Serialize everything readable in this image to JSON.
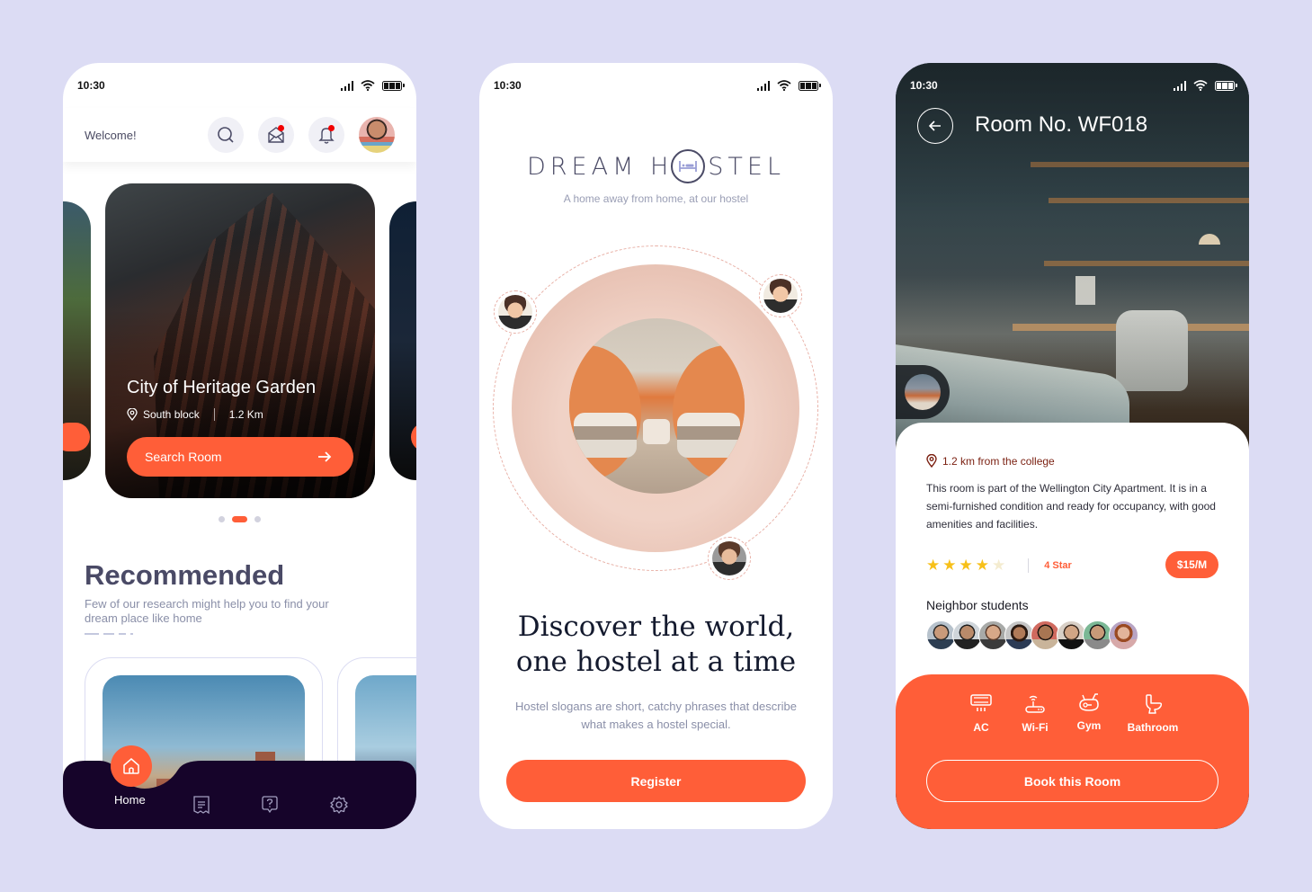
{
  "status_bar": {
    "time": "10:30"
  },
  "screen_home": {
    "header": {
      "welcome": "Welcome!",
      "icons": [
        "search-icon",
        "mail-icon",
        "bell-icon"
      ],
      "notification_dot_color": "#f20000"
    },
    "carousel": {
      "active_index": 1,
      "total": 3,
      "card": {
        "title": "City of Heritage Garden",
        "location": "South block",
        "distance": "1.2 Km",
        "button": "Search Room"
      }
    },
    "recommended": {
      "title": "Recommended",
      "subtitle": "Few of our research might help you to find your dream place like home"
    },
    "bottom_nav": {
      "items": [
        {
          "label": "Home",
          "icon": "home-icon",
          "active": true
        },
        {
          "label": "",
          "icon": "receipt-icon"
        },
        {
          "label": "",
          "icon": "help-icon"
        },
        {
          "label": "",
          "icon": "settings-icon"
        }
      ]
    }
  },
  "screen_onboarding": {
    "logo_left": "DREAM H",
    "logo_right": "STEL",
    "tagline": "A home away from home, at our hostel",
    "headline_line1": "Discover the world,",
    "headline_line2": "one hostel at a time",
    "description": "Hostel slogans are short, catchy phrases that describe what makes a hostel special.",
    "button": "Register"
  },
  "screen_room": {
    "title": "Room No. WF018",
    "distance": "1.2 km from the college",
    "description": "This room is part of the Wellington City Apartment. It is in a semi-furnished condition and ready for occupancy, with good amenities and facilities.",
    "rating": {
      "value": 4,
      "max": 5,
      "label": "4 Star"
    },
    "price": "$15/M",
    "neighbors_label": "Neighbor students",
    "neighbor_count": 8,
    "amenities": [
      {
        "label": "AC",
        "icon": "ac-icon"
      },
      {
        "label": "Wi-Fi",
        "icon": "router-icon"
      },
      {
        "label": "Gym",
        "icon": "exercise-bike-icon"
      },
      {
        "label": "Bathroom",
        "icon": "toilet-icon"
      }
    ],
    "button": "Book this Room"
  },
  "colors": {
    "accent": "#ff5e38",
    "nav_dark": "#16042a",
    "background": "#dcdcf4",
    "text_dark": "#4a4a66"
  }
}
